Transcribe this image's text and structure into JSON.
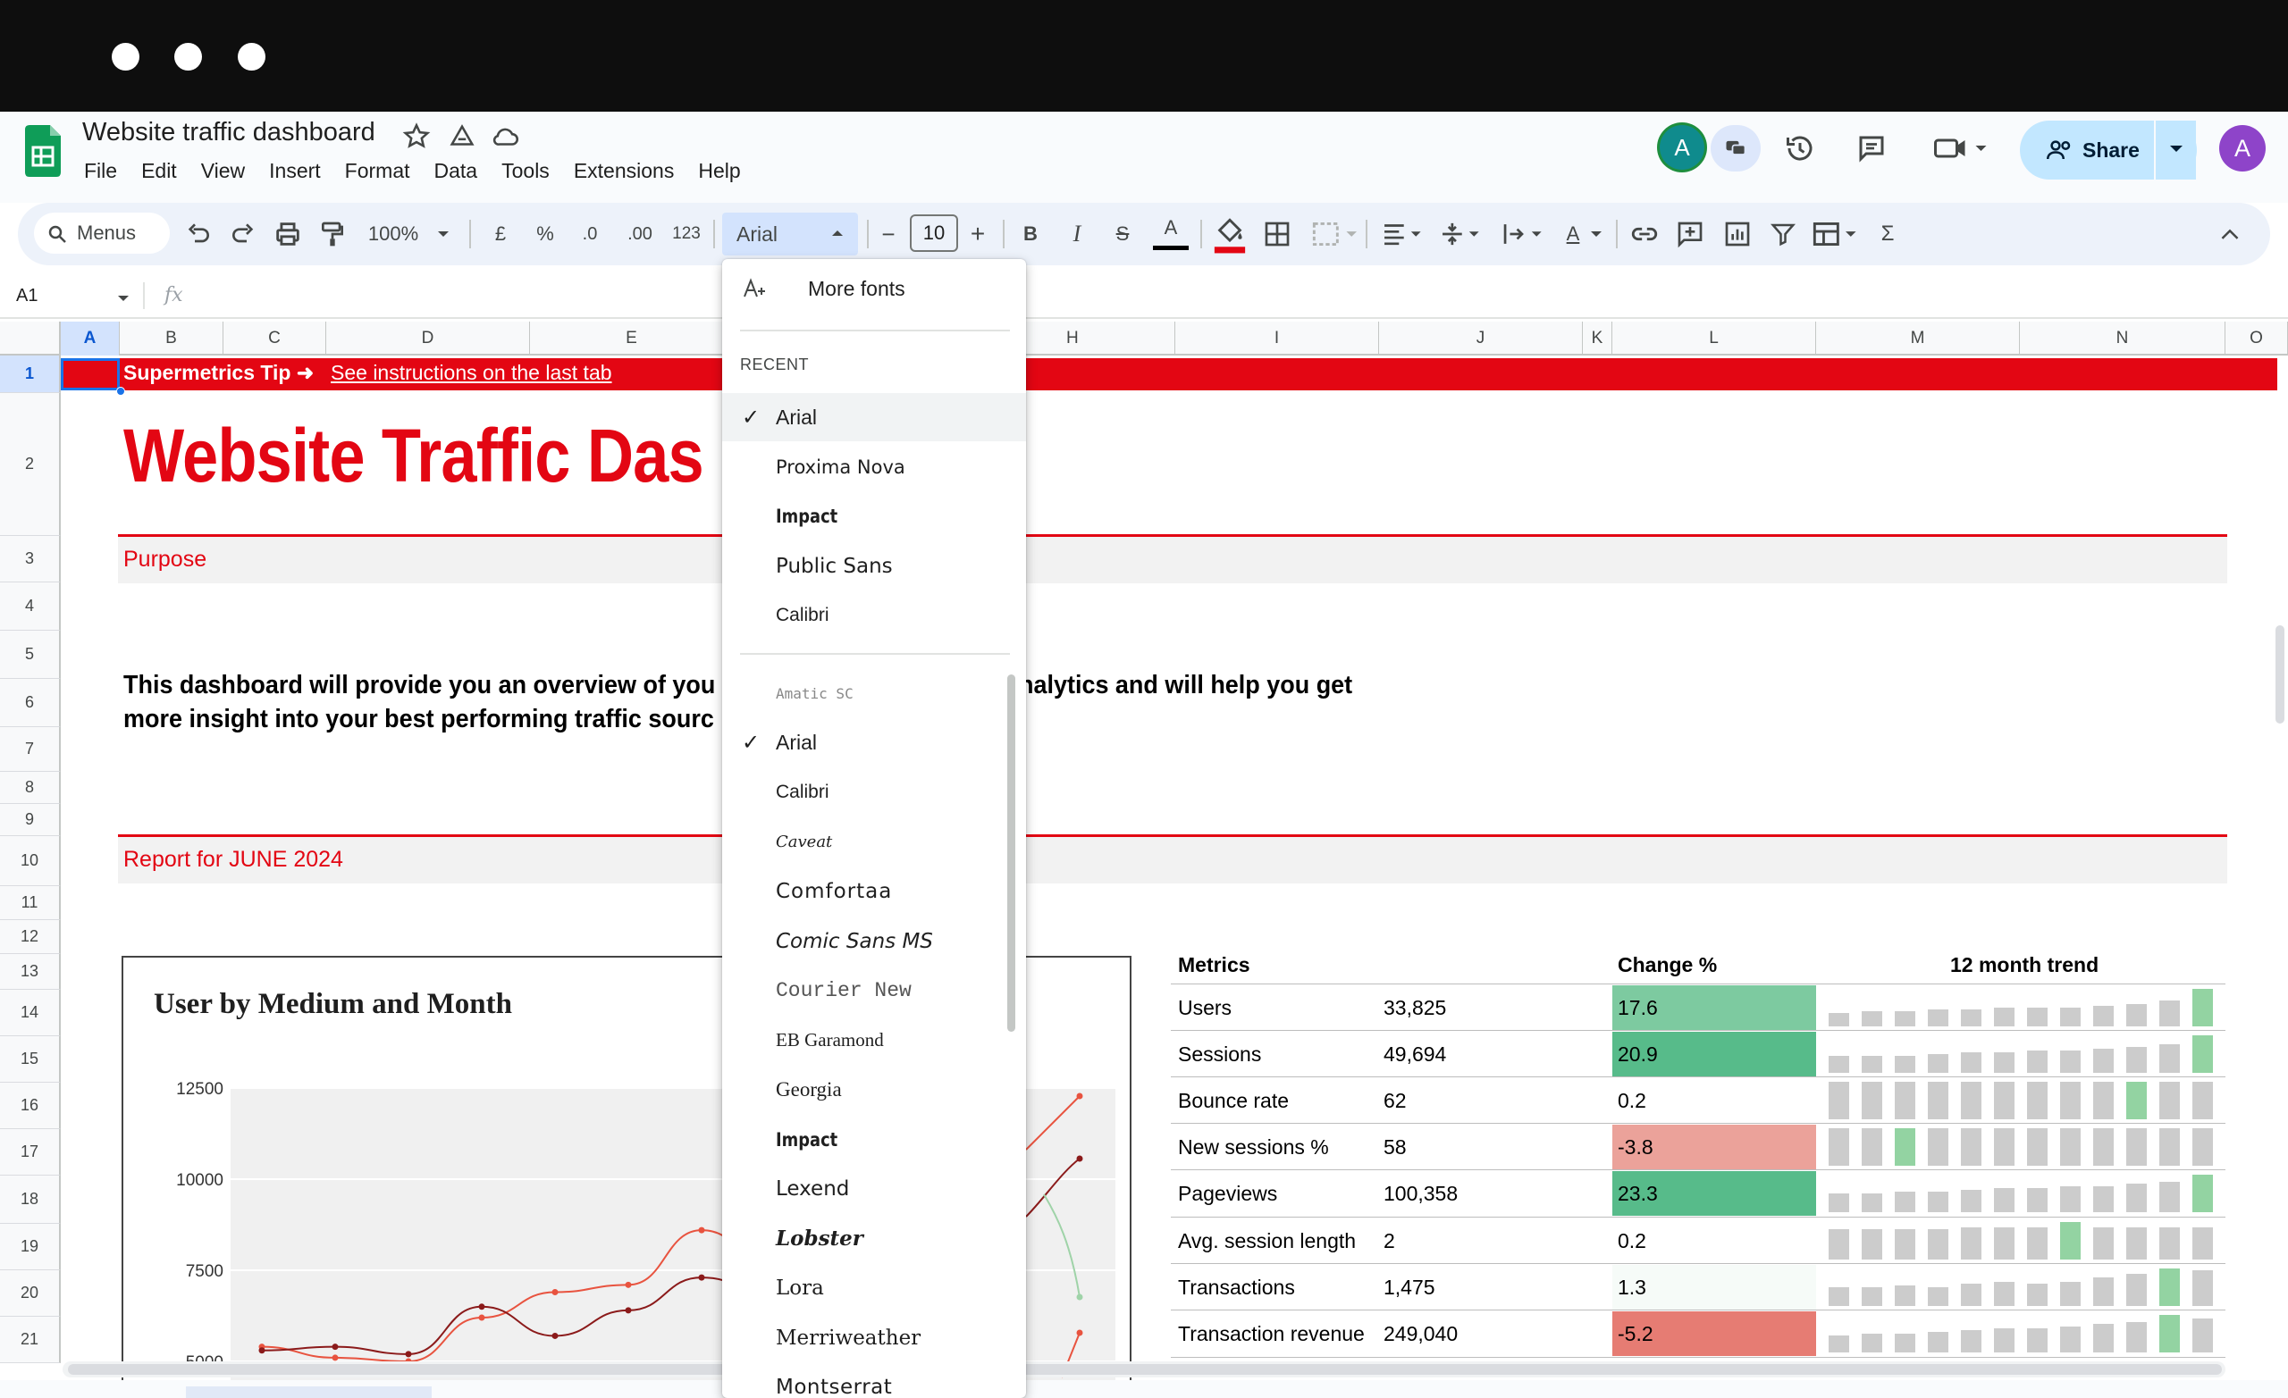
{
  "window": {
    "controls": [
      "close",
      "minimize",
      "maximize"
    ]
  },
  "app": {
    "title": "Website traffic dashboard",
    "menu": [
      "File",
      "Edit",
      "View",
      "Insert",
      "Format",
      "Data",
      "Tools",
      "Extensions",
      "Help"
    ],
    "avatar_letter": "A",
    "profile_letter": "A",
    "share_label": "Share"
  },
  "toolbar": {
    "search_placeholder": "Menus",
    "zoom": "100%",
    "currency": "£",
    "percent": "%",
    "dec_decrease": ".0",
    "dec_increase": ".00",
    "number_format": "123",
    "font": "Arial",
    "font_size": "10",
    "minus": "−",
    "plus": "+",
    "bold": "B",
    "italic": "I",
    "strike": "S",
    "text_color": "A",
    "text_rotation": "A",
    "sum": "Σ"
  },
  "formula_bar": {
    "cell_ref": "A1",
    "fx": "fx"
  },
  "columns": [
    "A",
    "B",
    "C",
    "D",
    "E",
    "H",
    "I",
    "J",
    "K",
    "L",
    "M",
    "N",
    "O"
  ],
  "rows": [
    "1",
    "2",
    "3",
    "4",
    "5",
    "6",
    "7",
    "8",
    "9",
    "10",
    "11",
    "12",
    "13",
    "14",
    "15",
    "16",
    "17",
    "18",
    "19",
    "20",
    "21"
  ],
  "sheet": {
    "tip_label": "Supermetrics Tip",
    "tip_arrow": "➜",
    "tip_link": "See instructions on the last tab",
    "big_title": "Website Traffic Das",
    "purpose": "Purpose",
    "intro_line1": "This dashboard will provide you an overview of you",
    "intro_line1_right": "nalytics and will help you get",
    "intro_line2": "more insight into your best performing traffic sourc",
    "report_label": "Report for JUNE 2024"
  },
  "chart_data": {
    "type": "line",
    "title": "User by Medium and Month",
    "y_ticks": [
      "12500",
      "10000",
      "7500",
      "5000"
    ],
    "ylim": [
      5000,
      12500
    ],
    "series": [
      {
        "color": "#e8533f",
        "points": [
          [
            0,
            5400
          ],
          [
            1,
            5100
          ],
          [
            2,
            5000
          ],
          [
            3,
            6200
          ],
          [
            4,
            6900
          ],
          [
            5,
            7100
          ],
          [
            6,
            8600
          ],
          [
            7,
            7600
          ]
        ]
      },
      {
        "color": "#8b1a1a",
        "points": [
          [
            0,
            5300
          ],
          [
            1,
            5400
          ],
          [
            2,
            5200
          ],
          [
            3,
            6500
          ],
          [
            4,
            5700
          ],
          [
            5,
            6400
          ],
          [
            6,
            7300
          ],
          [
            7,
            6800
          ]
        ]
      }
    ]
  },
  "metrics": {
    "headers": {
      "metric": "Metrics",
      "change": "Change %",
      "trend": "12 month trend"
    },
    "rows": [
      {
        "name": "Users",
        "value": "33,825",
        "change": "17.6",
        "bg": "#7dcaa0",
        "trend": [
          0.35,
          0.4,
          0.4,
          0.45,
          0.45,
          0.5,
          0.5,
          0.5,
          0.55,
          0.6,
          0.7,
          1.0
        ],
        "hl": 11
      },
      {
        "name": "Sessions",
        "value": "49,694",
        "change": "20.9",
        "bg": "#57bb8a",
        "trend": [
          0.45,
          0.45,
          0.45,
          0.5,
          0.55,
          0.55,
          0.6,
          0.6,
          0.65,
          0.7,
          0.75,
          1.0
        ],
        "hl": 11
      },
      {
        "name": "Bounce rate",
        "value": "62",
        "change": "0.2",
        "bg": "#ffffff",
        "trend": [
          1,
          1,
          1,
          1,
          1,
          1,
          1,
          1,
          1,
          1,
          1,
          1
        ],
        "hl": 9
      },
      {
        "name": "New sessions %",
        "value": "58",
        "change": "-3.8",
        "bg": "#eba29a",
        "trend": [
          1,
          1,
          1,
          1,
          1,
          1,
          1,
          1,
          1,
          1,
          1,
          1
        ],
        "hl": 2
      },
      {
        "name": "Pageviews",
        "value": "100,358",
        "change": "23.3",
        "bg": "#57bb8a",
        "trend": [
          0.5,
          0.5,
          0.55,
          0.55,
          0.6,
          0.65,
          0.65,
          0.7,
          0.7,
          0.75,
          0.8,
          1.0
        ],
        "hl": 11
      },
      {
        "name": "Avg. session length",
        "value": "2",
        "change": "0.2",
        "bg": "#ffffff",
        "trend": [
          0.8,
          0.8,
          0.8,
          0.8,
          0.85,
          0.85,
          0.85,
          1.0,
          0.85,
          0.85,
          0.85,
          0.85
        ],
        "hl": 7
      },
      {
        "name": "Transactions",
        "value": "1,475",
        "change": "1.3",
        "bg": "#f6fbf8",
        "trend": [
          0.5,
          0.5,
          0.55,
          0.5,
          0.6,
          0.65,
          0.6,
          0.65,
          0.75,
          0.85,
          1.0,
          0.95
        ],
        "hl": 10
      },
      {
        "name": "Transaction revenue",
        "value": "249,040",
        "change": "-5.2",
        "bg": "#e67c73",
        "trend": [
          0.45,
          0.5,
          0.5,
          0.55,
          0.6,
          0.65,
          0.65,
          0.7,
          0.75,
          0.8,
          1.0,
          0.9
        ],
        "hl": 10
      }
    ]
  },
  "font_menu": {
    "more_fonts": "More fonts",
    "recent_label": "RECENT",
    "recent": [
      "Arial",
      "Proxima Nova",
      "Impact",
      "Public Sans",
      "Calibri"
    ],
    "recent_selected": "Arial",
    "all": [
      "Amatic SC",
      "Arial",
      "Calibri",
      "Caveat",
      "Comfortaa",
      "Comic Sans MS",
      "Courier New",
      "EB Garamond",
      "Georgia",
      "Impact",
      "Lexend",
      "Lobster",
      "Lora",
      "Merriweather",
      "Montserrat"
    ],
    "all_selected": "Arial"
  },
  "colors": {
    "brand_red": "#e30613",
    "sheets_green": "#0f9d58",
    "share_bg": "#c2e7ff",
    "trend_gray": "#cccccc",
    "trend_green": "#93d3a2"
  }
}
